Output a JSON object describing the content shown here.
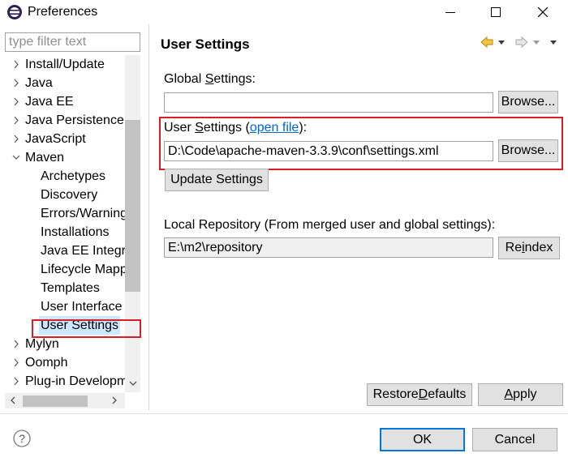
{
  "window": {
    "title": "Preferences",
    "minimize_glyph": "—",
    "maximize_glyph": "☐",
    "close_glyph": "✕"
  },
  "filter": {
    "placeholder": "type filter text",
    "value": ""
  },
  "tree": {
    "items": [
      {
        "label": "Install/Update",
        "expanded": false,
        "level": 0
      },
      {
        "label": "Java",
        "expanded": false,
        "level": 0
      },
      {
        "label": "Java EE",
        "expanded": false,
        "level": 0
      },
      {
        "label": "Java Persistence",
        "expanded": false,
        "level": 0
      },
      {
        "label": "JavaScript",
        "expanded": false,
        "level": 0
      },
      {
        "label": "Maven",
        "expanded": true,
        "level": 0
      },
      {
        "label": "Archetypes",
        "level": 1
      },
      {
        "label": "Discovery",
        "level": 1
      },
      {
        "label": "Errors/Warnings",
        "level": 1
      },
      {
        "label": "Installations",
        "level": 1
      },
      {
        "label": "Java EE Integration",
        "level": 1
      },
      {
        "label": "Lifecycle Mappings",
        "level": 1
      },
      {
        "label": "Templates",
        "level": 1
      },
      {
        "label": "User Interface",
        "level": 1
      },
      {
        "label": "User Settings",
        "level": 1,
        "selected": true
      },
      {
        "label": "Mylyn",
        "expanded": false,
        "level": 0
      },
      {
        "label": "Oomph",
        "expanded": false,
        "level": 0
      },
      {
        "label": "Plug-in Development",
        "expanded": false,
        "level": 0
      }
    ],
    "scroll_left_glyph": "‹",
    "scroll_right_glyph": "›"
  },
  "page": {
    "title": "User Settings",
    "global": {
      "label_pre": "Global ",
      "label_mnemonic": "S",
      "label_post": "ettings:",
      "value": "",
      "browse_label": "Browse..."
    },
    "user": {
      "label_pre": "User ",
      "label_mnemonic": "S",
      "label_post": "ettings (",
      "link": "open file",
      "label_end": "):",
      "value": "D:\\Code\\apache-maven-3.3.9\\conf\\settings.xml",
      "browse_label": "Browse..."
    },
    "update_label": "Update Settings",
    "local_repo": {
      "label": "Local Repository (From merged user and global settings):",
      "value": "E:\\m2\\repository",
      "reindex_pre": "Re",
      "reindex_mnemonic": "i",
      "reindex_post": "ndex"
    },
    "restore": {
      "pre": "Restore ",
      "mnemonic": "D",
      "post": "efaults"
    },
    "apply": {
      "mnemonic": "A",
      "post": "pply"
    }
  },
  "footer": {
    "ok_label": "OK",
    "cancel_label": "Cancel",
    "help_glyph": "?"
  },
  "colors": {
    "highlight_border": "#d61f26",
    "link": "#0066cc",
    "selection": "#cce8ff",
    "primary_border": "#0078d7",
    "arrow_back": "#e8b020"
  }
}
